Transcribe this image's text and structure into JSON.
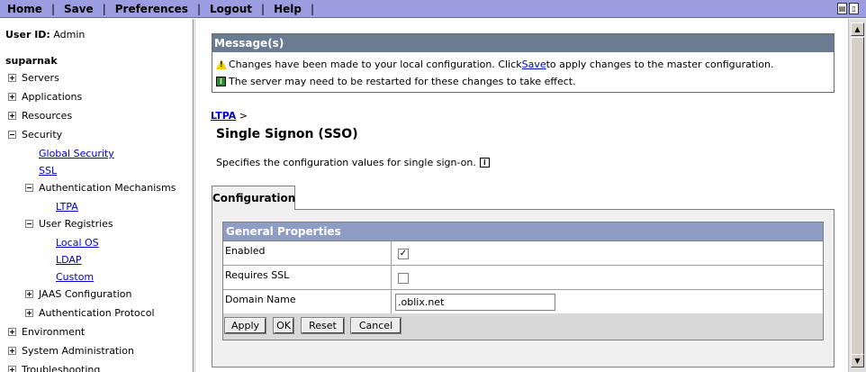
{
  "topnav": {
    "home": "Home",
    "save": "Save",
    "preferences": "Preferences",
    "logout": "Logout",
    "help": "Help",
    "separator": "|"
  },
  "user": {
    "id_label": "User ID:",
    "id_value": "Admin",
    "node": "suparnak"
  },
  "tree": {
    "servers": "Servers",
    "applications": "Applications",
    "resources": "Resources",
    "security": "Security",
    "global_security": "Global Security",
    "ssl": "SSL",
    "auth_mechanisms": "Authentication Mechanisms",
    "ltpa": "LTPA",
    "user_registries": "User Registries",
    "local_os": "Local OS",
    "ldap": "LDAP",
    "custom": "Custom",
    "jaas": "JAAS Configuration",
    "auth_protocol": "Authentication Protocol",
    "environment": "Environment",
    "system_admin": "System Administration",
    "troubleshooting": "Troubleshooting"
  },
  "messages": {
    "title": "Message(s)",
    "warn_before": "Changes have been made to your local configuration. Click ",
    "warn_link": "Save ",
    "warn_after": "to apply changes to the master configuration.",
    "info": "The server may need to be restarted for these changes to take effect."
  },
  "breadcrumb": {
    "link": "LTPA",
    "sep": ">"
  },
  "page": {
    "title": "Single Signon (SSO)",
    "description": "Specifies the configuration values for single sign-on."
  },
  "tab": {
    "label": "Configuration"
  },
  "props": {
    "header": "General Properties",
    "enabled_label": "Enabled",
    "enabled_checked": true,
    "enabled_mark": "✓",
    "ssl_label": "Requires SSL",
    "ssl_checked": false,
    "domain_label": "Domain Name",
    "domain_value": ".oblix.net"
  },
  "buttons": {
    "apply": "Apply",
    "ok": "OK",
    "reset": "Reset",
    "cancel": "Cancel"
  }
}
